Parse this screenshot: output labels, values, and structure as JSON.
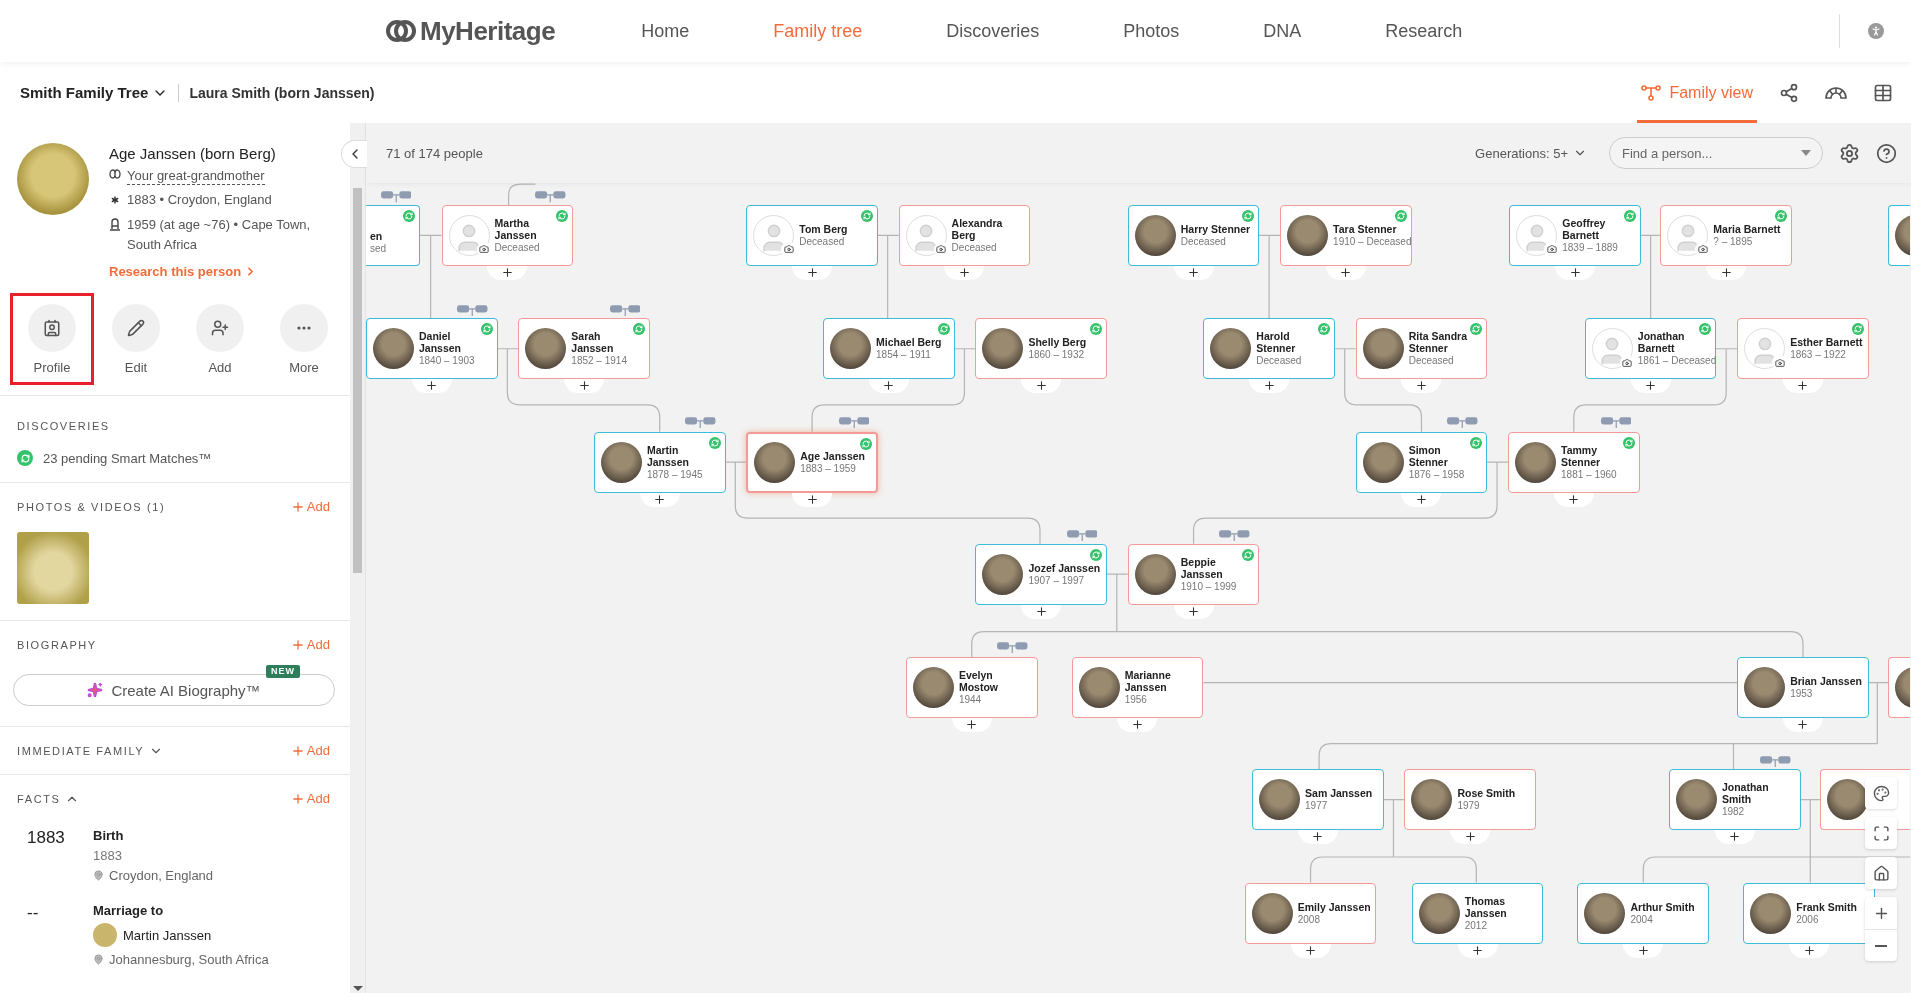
{
  "top_nav": {
    "logo": "MyHeritage",
    "items": [
      {
        "label": "Home",
        "selected": false
      },
      {
        "label": "Family tree",
        "selected": true
      },
      {
        "label": "Discoveries",
        "selected": false
      },
      {
        "label": "Photos",
        "selected": false
      },
      {
        "label": "DNA",
        "selected": false
      },
      {
        "label": "Research",
        "selected": false
      }
    ]
  },
  "tree_bar": {
    "tree_name": "Smith Family Tree",
    "home_person": "Laura Smith (born Janssen)",
    "views": [
      {
        "kind": "family",
        "label": "Family view",
        "selected": true
      },
      {
        "kind": "pedigree",
        "selected": false
      },
      {
        "kind": "fan",
        "selected": false
      },
      {
        "kind": "list",
        "selected": false
      }
    ]
  },
  "sidebar": {
    "person": {
      "name": "Age Janssen (born Berg)",
      "relation": "Your great-grandmother",
      "birth": "1883 • Croydon, England",
      "death": "1959 (at age ~76) • Cape Town, South Africa",
      "research_link": "Research this person"
    },
    "actions": [
      {
        "kind": "profile",
        "label": "Profile",
        "highlighted": true
      },
      {
        "kind": "edit",
        "label": "Edit",
        "highlighted": false
      },
      {
        "kind": "add",
        "label": "Add",
        "highlighted": false
      },
      {
        "kind": "more",
        "label": "More",
        "highlighted": false
      }
    ],
    "discoveries": {
      "title": "DISCOVERIES",
      "matches": "23 pending Smart Matches™"
    },
    "photos": {
      "title": "PHOTOS & VIDEOS (1)",
      "add": "Add"
    },
    "biography": {
      "title": "BIOGRAPHY",
      "add": "Add",
      "button": "Create AI Biography™",
      "badge": "NEW"
    },
    "immediate_family": {
      "title": "IMMEDIATE FAMILY",
      "add": "Add",
      "expanded": false
    },
    "facts": {
      "title": "FACTS",
      "add": "Add",
      "expanded": true,
      "items": [
        {
          "kind": "event",
          "year": "1883",
          "title": "Birth",
          "date": "1883",
          "place": "Croydon, England"
        },
        {
          "kind": "marriage",
          "year": "--",
          "title": "Marriage to",
          "spouse": "Martin Janssen",
          "place": "Johannesburg, South Africa"
        }
      ]
    }
  },
  "canvas": {
    "count": "71 of 174 people",
    "generations_label": "Generations:",
    "generations_value": "5+",
    "search": {
      "placeholder": "Find a person..."
    }
  },
  "tree": {
    "nodes": [
      {
        "kind": "cut_left",
        "name": "en",
        "dates": "sed",
        "color": "#3cbcd8",
        "matches": true,
        "selected": false
      },
      {
        "kind": "card",
        "name": "Martha Janssen",
        "dates": "Deceased",
        "color": "#f49b98",
        "has_photo": false,
        "matches": true,
        "selected": false
      },
      {
        "kind": "card",
        "name": "Tom Berg",
        "dates": "Deceased",
        "color": "#3cbcd8",
        "has_photo": false,
        "matches": true,
        "selected": false
      },
      {
        "kind": "card",
        "name": "Alexandra Berg",
        "dates": "Deceased",
        "color": "#f49b98",
        "has_photo": false,
        "matches": false,
        "selected": false
      },
      {
        "kind": "card",
        "name": "Harry Stenner",
        "dates": "Deceased",
        "color": "#3cbcd8",
        "has_photo": true,
        "matches": true,
        "selected": false
      },
      {
        "kind": "card",
        "name": "Tara Stenner",
        "dates": "1910 – Deceased",
        "color": "#f49b98",
        "has_photo": true,
        "matches": true,
        "selected": false
      },
      {
        "kind": "card",
        "name": "Geoffrey Barnett",
        "dates": "1839 – 1889",
        "color": "#3cbcd8",
        "has_photo": false,
        "matches": true,
        "selected": false
      },
      {
        "kind": "card",
        "name": "Maria Barnett",
        "dates": "? – 1895",
        "color": "#f49b98",
        "has_photo": false,
        "matches": true,
        "selected": false
      },
      {
        "kind": "cut_right",
        "color": "#3cbcd8",
        "has_photo": true,
        "matches": false,
        "selected": false
      },
      {
        "kind": "card",
        "name": "Daniel Janssen",
        "dates": "1840 – 1903",
        "color": "#3cbcd8",
        "has_photo": true,
        "matches": true,
        "selected": false
      },
      {
        "kind": "card",
        "name": "Sarah Janssen",
        "dates": "1852 – 1914",
        "color": "#f49b98",
        "has_photo": true,
        "matches": true,
        "selected": false
      },
      {
        "kind": "card",
        "name": "Michael Berg",
        "dates": "1854 – 1911",
        "color": "#3cbcd8",
        "has_photo": true,
        "matches": true,
        "selected": false
      },
      {
        "kind": "card",
        "name": "Shelly Berg",
        "dates": "1860 – 1932",
        "color": "#f49b98",
        "has_photo": true,
        "matches": true,
        "selected": false
      },
      {
        "kind": "card",
        "name": "Harold Stenner",
        "dates": "Deceased",
        "color": "#3cbcd8",
        "has_photo": true,
        "matches": true,
        "selected": false
      },
      {
        "kind": "card",
        "name": "Rita Sandra Stenner",
        "dates": "Deceased",
        "color": "#f49b98",
        "has_photo": true,
        "matches": true,
        "selected": false
      },
      {
        "kind": "card",
        "name": "Jonathan Barnett",
        "dates": "1861 – Deceased",
        "color": "#3cbcd8",
        "has_photo": false,
        "matches": true,
        "selected": false
      },
      {
        "kind": "card",
        "name": "Esther Barnett",
        "dates": "1863 – 1922",
        "color": "#f49b98",
        "has_photo": false,
        "matches": true,
        "selected": false
      },
      {
        "kind": "card",
        "name": "Martin Janssen",
        "dates": "1878 – 1945",
        "color": "#3cbcd8",
        "has_photo": true,
        "matches": true,
        "selected": false
      },
      {
        "kind": "card",
        "name": "Age Janssen",
        "dates": "1883 – 1959",
        "color": "#f49b98",
        "has_photo": true,
        "matches": true,
        "selected": true
      },
      {
        "kind": "card",
        "name": "Simon Stenner",
        "dates": "1876 – 1958",
        "color": "#3cbcd8",
        "has_photo": true,
        "matches": true,
        "selected": false
      },
      {
        "kind": "card",
        "name": "Tammy Stenner",
        "dates": "1881 – 1960",
        "color": "#f49b98",
        "has_photo": true,
        "matches": true,
        "selected": false
      },
      {
        "kind": "card",
        "name": "Jozef Janssen",
        "dates": "1907 – 1997",
        "color": "#3cbcd8",
        "has_photo": true,
        "matches": true,
        "selected": false
      },
      {
        "kind": "card",
        "name": "Beppie Janssen",
        "dates": "1910 – 1999",
        "color": "#f49b98",
        "has_photo": true,
        "matches": true,
        "selected": false
      },
      {
        "kind": "card",
        "name": "Evelyn Mostow",
        "dates": "1944",
        "color": "#f49b98",
        "has_photo": true,
        "matches": false,
        "selected": false
      },
      {
        "kind": "card",
        "name": "Marianne Janssen",
        "dates": "1956",
        "color": "#f49b98",
        "has_photo": true,
        "matches": false,
        "selected": false
      },
      {
        "kind": "card",
        "name": "Brian Janssen",
        "dates": "1953",
        "color": "#3cbcd8",
        "has_photo": true,
        "matches": false,
        "selected": false
      },
      {
        "kind": "cut_right",
        "color": "#f49b98",
        "has_photo": true,
        "matches": false,
        "selected": false
      },
      {
        "kind": "card",
        "name": "Sam Janssen",
        "dates": "1977",
        "color": "#3cbcd8",
        "has_photo": true,
        "matches": false,
        "selected": false
      },
      {
        "kind": "card",
        "name": "Rose Smith",
        "dates": "1979",
        "color": "#f49b98",
        "has_photo": true,
        "matches": false,
        "selected": false
      },
      {
        "kind": "card",
        "name": "Jonathan Smith",
        "dates": "1982",
        "color": "#3cbcd8",
        "has_photo": true,
        "matches": false,
        "selected": false
      },
      {
        "kind": "cut_right",
        "color": "#f49b98",
        "has_photo": true,
        "matches": false,
        "selected": false
      },
      {
        "kind": "card",
        "name": "Emily Janssen",
        "dates": "2008",
        "color": "#f49b98",
        "has_photo": true,
        "matches": false,
        "selected": false
      },
      {
        "kind": "card",
        "name": "Thomas Janssen",
        "dates": "2012",
        "color": "#3cbcd8",
        "has_photo": true,
        "matches": false,
        "selected": false
      },
      {
        "kind": "card",
        "name": "Arthur Smith",
        "dates": "2004",
        "color": "#3cbcd8",
        "has_photo": true,
        "matches": false,
        "selected": false
      },
      {
        "kind": "card",
        "name": "Frank Smith",
        "dates": "2006",
        "color": "#3cbcd8",
        "has_photo": true,
        "matches": false,
        "selected": false
      }
    ]
  }
}
